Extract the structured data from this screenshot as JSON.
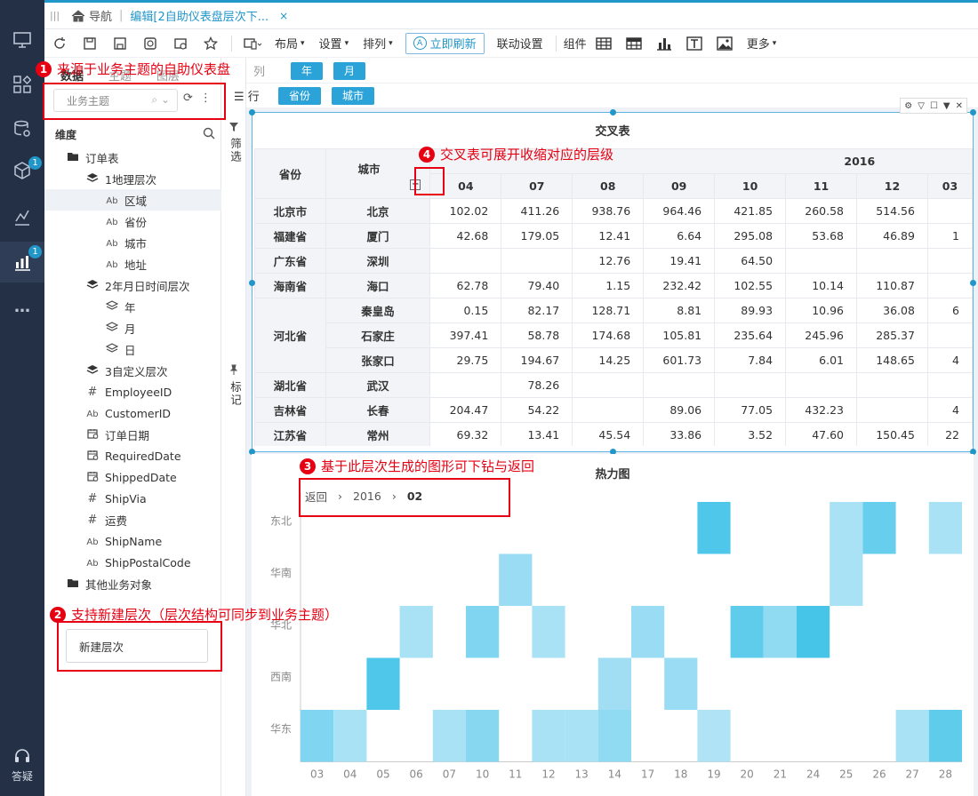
{
  "tabbar": {
    "home": "导航",
    "doc": "编辑[2自助仪表盘层次下...",
    "close": "×"
  },
  "toolbar": {
    "layout": "布局",
    "settings": "设置",
    "arrange": "排列",
    "refresh": "立即刷新",
    "linkage": "联动设置",
    "group": "组件",
    "more": "更多"
  },
  "leftnav": {
    "badge_a": "1",
    "badge_b": "1",
    "more": "…",
    "answer": "答疑"
  },
  "panel": {
    "tabs": [
      "数据",
      "主题",
      "图层"
    ],
    "subject_placeholder": "业务主题",
    "dimension": "维度",
    "tree": [
      {
        "label": "订单表",
        "icon": "folder-icon",
        "indent": 0
      },
      {
        "label": "1地理层次",
        "icon": "layers-icon",
        "indent": 1
      },
      {
        "label": "区域",
        "icon": "text-field-icon",
        "indent": 2,
        "selected": true
      },
      {
        "label": "省份",
        "icon": "text-field-icon",
        "indent": 2
      },
      {
        "label": "城市",
        "icon": "text-field-icon",
        "indent": 2
      },
      {
        "label": "地址",
        "icon": "text-field-icon",
        "indent": 2
      },
      {
        "label": "2年月日时间层次",
        "icon": "layers-icon",
        "indent": 1
      },
      {
        "label": "年",
        "icon": "layer-outline-icon",
        "indent": 2
      },
      {
        "label": "月",
        "icon": "layer-outline-icon",
        "indent": 2
      },
      {
        "label": "日",
        "icon": "layer-outline-icon",
        "indent": 2
      },
      {
        "label": "3自定义层次",
        "icon": "layers-icon",
        "indent": 1
      },
      {
        "label": "EmployeeID",
        "icon": "number-field-icon",
        "indent": 1
      },
      {
        "label": "CustomerID",
        "icon": "text-field-icon",
        "indent": 1
      },
      {
        "label": "订单日期",
        "icon": "date-field-icon",
        "indent": 1
      },
      {
        "label": "RequiredDate",
        "icon": "date-field-icon",
        "indent": 1
      },
      {
        "label": "ShippedDate",
        "icon": "date-field-icon",
        "indent": 1
      },
      {
        "label": "ShipVia",
        "icon": "number-field-icon",
        "indent": 1
      },
      {
        "label": "运费",
        "icon": "number-field-icon",
        "indent": 1
      },
      {
        "label": "ShipName",
        "icon": "text-field-icon",
        "indent": 1
      },
      {
        "label": "ShipPostalCode",
        "icon": "text-field-icon",
        "indent": 1
      },
      {
        "label": "其他业务对象",
        "icon": "folder-icon",
        "indent": 0
      }
    ],
    "new_hierarchy": "新建层次"
  },
  "side": {
    "filter": "筛选",
    "mark": "标记"
  },
  "shelves": {
    "col_label": "列",
    "col_pills": [
      "年",
      "月"
    ],
    "row_label": "行",
    "row_pills": [
      "省份",
      "城市"
    ]
  },
  "crosstab": {
    "title": "交叉表",
    "h_province": "省份",
    "h_city": "城市",
    "year": "2016",
    "months": [
      "04",
      "07",
      "08",
      "09",
      "10",
      "11",
      "12",
      "03"
    ],
    "rows": [
      {
        "province": "北京市",
        "span": 1,
        "city": "北京",
        "v": [
          "102.02",
          "411.26",
          "938.76",
          "964.46",
          "421.85",
          "260.58",
          "514.56",
          ""
        ]
      },
      {
        "province": "福建省",
        "span": 1,
        "city": "厦门",
        "v": [
          "42.68",
          "179.05",
          "12.41",
          "6.64",
          "295.08",
          "53.68",
          "46.89",
          "1"
        ]
      },
      {
        "province": "广东省",
        "span": 1,
        "city": "深圳",
        "v": [
          "",
          "",
          "12.76",
          "19.41",
          "64.50",
          "",
          "",
          ""
        ]
      },
      {
        "province": "海南省",
        "span": 1,
        "city": "海口",
        "v": [
          "62.78",
          "79.40",
          "1.15",
          "232.42",
          "102.55",
          "10.14",
          "110.87",
          ""
        ]
      },
      {
        "province": "河北省",
        "span": 3,
        "city": "秦皇岛",
        "v": [
          "0.15",
          "82.17",
          "128.71",
          "8.81",
          "89.93",
          "10.96",
          "36.08",
          "6"
        ]
      },
      {
        "province": "",
        "span": 0,
        "city": "石家庄",
        "v": [
          "397.41",
          "58.78",
          "174.68",
          "105.81",
          "235.64",
          "245.96",
          "285.37",
          ""
        ]
      },
      {
        "province": "",
        "span": 0,
        "city": "张家口",
        "v": [
          "29.75",
          "194.67",
          "14.25",
          "601.73",
          "7.84",
          "6.01",
          "148.65",
          "4"
        ]
      },
      {
        "province": "湖北省",
        "span": 1,
        "city": "武汉",
        "v": [
          "",
          "78.26",
          "",
          "",
          "",
          "",
          "",
          ""
        ]
      },
      {
        "province": "吉林省",
        "span": 1,
        "city": "长春",
        "v": [
          "204.47",
          "54.22",
          "",
          "89.06",
          "77.05",
          "432.23",
          "",
          "4"
        ]
      },
      {
        "province": "江苏省",
        "span": 1,
        "city": "常州",
        "v": [
          "69.32",
          "13.41",
          "45.54",
          "33.86",
          "3.52",
          "47.60",
          "150.45",
          "22"
        ]
      }
    ]
  },
  "heatmap": {
    "title": "热力图",
    "crumbs": [
      "返回",
      "2016",
      "02"
    ],
    "chart_data": {
      "type": "heatmap",
      "title": "热力图",
      "x": [
        "03",
        "04",
        "05",
        "06",
        "07",
        "10",
        "11",
        "12",
        "13",
        "14",
        "17",
        "18",
        "19",
        "20",
        "21",
        "24",
        "25",
        "26",
        "27",
        "28"
      ],
      "y": [
        "东北",
        "华南",
        "华北",
        "西南",
        "华东"
      ],
      "cells": [
        {
          "x": "19",
          "y": "东北",
          "level": 0.8
        },
        {
          "x": "25",
          "y": "东北",
          "level": 0.25
        },
        {
          "x": "26",
          "y": "东北",
          "level": 0.65
        },
        {
          "x": "28",
          "y": "东北",
          "level": 0.25
        },
        {
          "x": "11",
          "y": "华南",
          "level": 0.35
        },
        {
          "x": "25",
          "y": "华南",
          "level": 0.25
        },
        {
          "x": "06",
          "y": "华北",
          "level": 0.25
        },
        {
          "x": "10",
          "y": "华北",
          "level": 0.5
        },
        {
          "x": "12",
          "y": "华北",
          "level": 0.25
        },
        {
          "x": "17",
          "y": "华北",
          "level": 0.35
        },
        {
          "x": "20",
          "y": "华北",
          "level": 0.7
        },
        {
          "x": "21",
          "y": "华北",
          "level": 0.4
        },
        {
          "x": "24",
          "y": "华北",
          "level": 0.85
        },
        {
          "x": "05",
          "y": "西南",
          "level": 0.8
        },
        {
          "x": "14",
          "y": "西南",
          "level": 0.3
        },
        {
          "x": "18",
          "y": "西南",
          "level": 0.35
        },
        {
          "x": "03",
          "y": "华东",
          "level": 0.5
        },
        {
          "x": "04",
          "y": "华东",
          "level": 0.25
        },
        {
          "x": "07",
          "y": "华东",
          "level": 0.25
        },
        {
          "x": "10",
          "y": "华东",
          "level": 0.45
        },
        {
          "x": "12",
          "y": "华东",
          "level": 0.25
        },
        {
          "x": "13",
          "y": "华东",
          "level": 0.25
        },
        {
          "x": "14",
          "y": "华东",
          "level": 0.4
        },
        {
          "x": "19",
          "y": "华东",
          "level": 0.2
        },
        {
          "x": "27",
          "y": "华东",
          "level": 0.25
        },
        {
          "x": "28",
          "y": "华东",
          "level": 0.7
        }
      ],
      "colors": {
        "low": "#d2ecfa",
        "high": "#2ebee6"
      }
    }
  },
  "annotations": {
    "a1": "来源于业务主题的自助仪表盘",
    "a2": "支持新建层次（层次结构可同步到业务主题）",
    "a3": "基于此层次生成的图形可下钻与返回",
    "a4": "交叉表可展开收缩对应的层级",
    "n1": "1",
    "n2": "2",
    "n3": "3",
    "n4": "4"
  }
}
